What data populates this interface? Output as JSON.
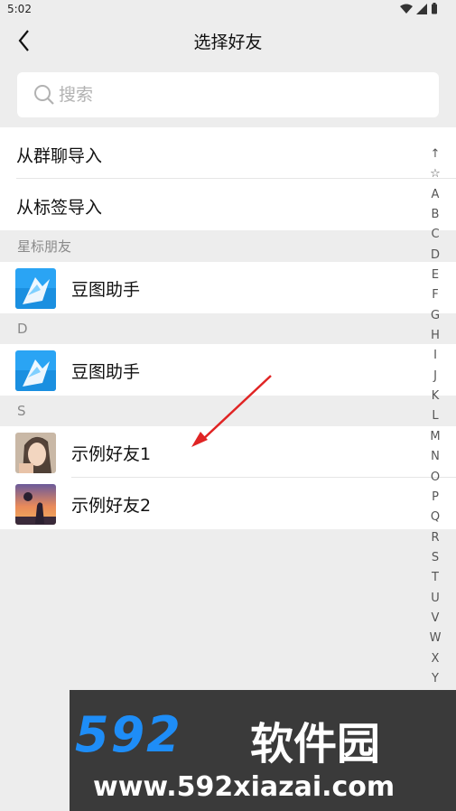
{
  "status_bar": {
    "time": "5:02"
  },
  "header": {
    "title": "选择好友"
  },
  "search": {
    "placeholder": "搜索",
    "value": ""
  },
  "actions": [
    {
      "label": "从群聊导入"
    },
    {
      "label": "从标签导入"
    }
  ],
  "sections": [
    {
      "title": "星标朋友",
      "contacts": [
        {
          "name": "豆图助手",
          "avatar": "app-logo"
        }
      ]
    },
    {
      "title": "D",
      "contacts": [
        {
          "name": "豆图助手",
          "avatar": "app-logo"
        }
      ]
    },
    {
      "title": "S",
      "contacts": [
        {
          "name": "示例好友1",
          "avatar": "photo-girl"
        },
        {
          "name": "示例好友2",
          "avatar": "photo-sunset"
        }
      ]
    }
  ],
  "index_bar": [
    "↑",
    "☆",
    "A",
    "B",
    "C",
    "D",
    "E",
    "F",
    "G",
    "H",
    "I",
    "J",
    "K",
    "L",
    "M",
    "N",
    "O",
    "P",
    "Q",
    "R",
    "S",
    "T",
    "U",
    "V",
    "W",
    "X",
    "Y"
  ],
  "watermark": {
    "logo": "592",
    "brand": "软件园",
    "url": "www.592xiazai.com"
  },
  "colors": {
    "background": "#ededed",
    "watermark_blue": "#1e8df7",
    "arrow": "#e02424"
  }
}
